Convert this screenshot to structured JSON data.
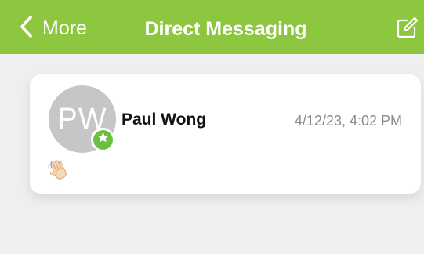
{
  "nav": {
    "back_label": "More",
    "title": "Direct Messaging",
    "back_icon": "chevron-left-icon",
    "compose_icon": "compose-icon",
    "bar_color": "#8dc63f"
  },
  "messages": [
    {
      "avatar_initials": "PW",
      "sender": "Paul Wong",
      "timestamp": "4/12/23, 4:02 PM",
      "preview_icon": "waving-hand-emoji",
      "badge_icon": "star-icon",
      "badge_color": "#6cbf3f"
    }
  ]
}
